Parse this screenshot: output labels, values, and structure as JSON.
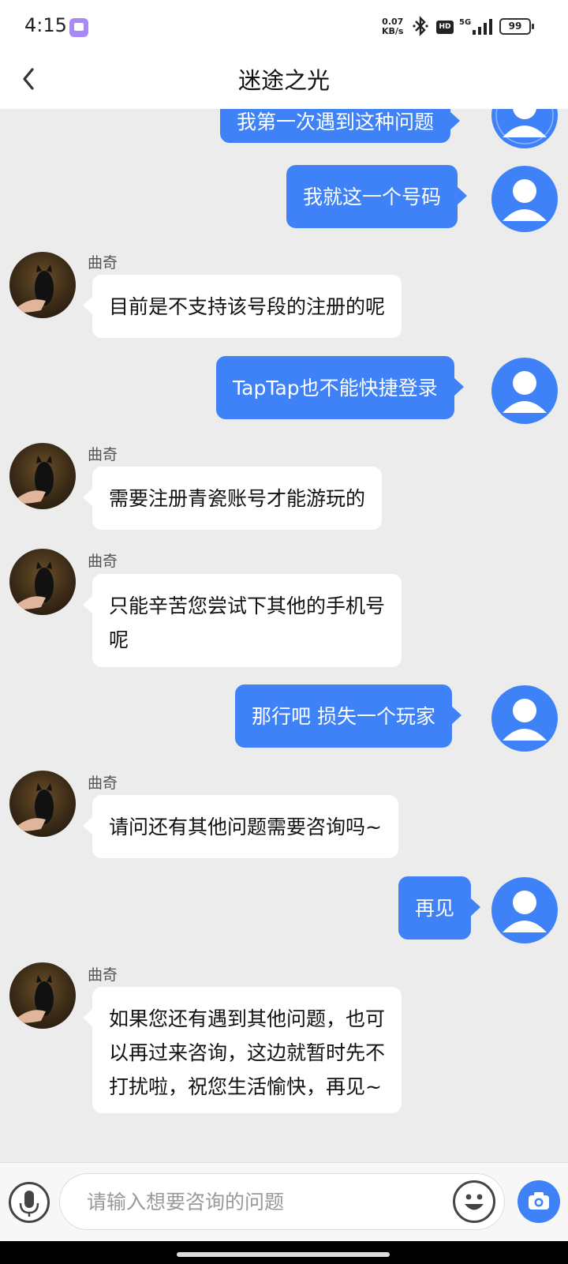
{
  "status_bar": {
    "time": "4:15",
    "net_speed_value": "0.07",
    "net_speed_unit": "KB/s",
    "hd_label": "HD",
    "signal_label": "5G",
    "battery": "99"
  },
  "header": {
    "title": "迷途之光"
  },
  "messages": [
    {
      "sender": "user",
      "text": "我第一次遇到这种问题"
    },
    {
      "sender": "user",
      "text": "我就这一个号码"
    },
    {
      "sender": "agent",
      "name": "曲奇",
      "text": "目前是不支持该号段的注册的呢"
    },
    {
      "sender": "user",
      "text": "TapTap也不能快捷登录"
    },
    {
      "sender": "agent",
      "name": "曲奇",
      "text": "需要注册青瓷账号才能游玩的"
    },
    {
      "sender": "agent",
      "name": "曲奇",
      "text": "只能辛苦您尝试下其他的手机号\n呢"
    },
    {
      "sender": "user",
      "text": "那行吧 损失一个玩家"
    },
    {
      "sender": "agent",
      "name": "曲奇",
      "text": "请问还有其他问题需要咨询吗~"
    },
    {
      "sender": "user",
      "text": "再见"
    },
    {
      "sender": "agent",
      "name": "曲奇",
      "text": "如果您还有遇到其他问题，也可\n以再过来咨询，这边就暂时先不\n打扰啦，祝您生活愉快，再见~"
    }
  ],
  "input_bar": {
    "placeholder": "请输入想要咨询的问题"
  },
  "colors": {
    "accent": "#3f82f7",
    "background": "#ececec"
  },
  "icons": [
    "back-icon",
    "microphone-icon",
    "emoji-icon",
    "camera-icon",
    "user-avatar-icon",
    "agent-avatar-cat"
  ]
}
